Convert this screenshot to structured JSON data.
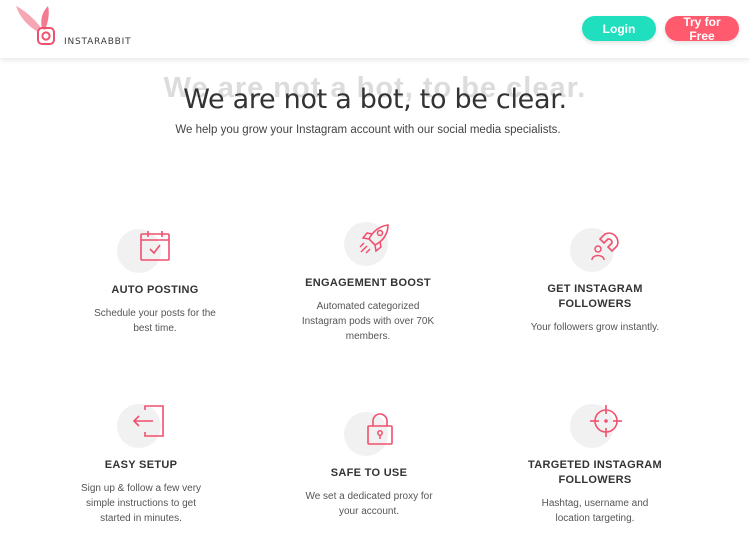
{
  "header": {
    "brand": "INSTARABBIT",
    "login_label": "Login",
    "try_label": "Try for Free"
  },
  "hero": {
    "shadow_text": "We are not a bot, to be clear.",
    "title": "We are not a bot, to be clear.",
    "subtitle": "We help you grow your Instagram account with our social media specialists."
  },
  "features": [
    {
      "icon": "calendar-check-icon",
      "title": "AUTO POSTING",
      "desc_lines": [
        "Schedule your posts for the",
        "best time."
      ]
    },
    {
      "icon": "rocket-icon",
      "title": "ENGAGEMENT BOOST",
      "desc_lines": [
        "Automated categorized",
        "Instagram pods with over 70K",
        "members."
      ]
    },
    {
      "icon": "magnet-user-icon",
      "title_lines": [
        "GET INSTAGRAM",
        "FOLLOWERS"
      ],
      "desc_lines": [
        "Your followers grow instantly."
      ]
    },
    {
      "icon": "enter-door-icon",
      "title": "EASY SETUP",
      "desc_lines": [
        "Sign up & follow a few very",
        "simple instructions to get",
        "started in minutes."
      ]
    },
    {
      "icon": "padlock-icon",
      "title": "SAFE TO USE",
      "desc_lines": [
        "We set a dedicated proxy for",
        "your account."
      ]
    },
    {
      "icon": "crosshair-target-icon",
      "title_lines": [
        "TARGETED INSTAGRAM",
        "FOLLOWERS"
      ],
      "desc_lines": [
        "Hashtag, username and",
        "location targeting."
      ]
    }
  ],
  "colors": {
    "accent": "#f0506e",
    "login": "#20dfbf",
    "try": "#ff5a6e"
  }
}
